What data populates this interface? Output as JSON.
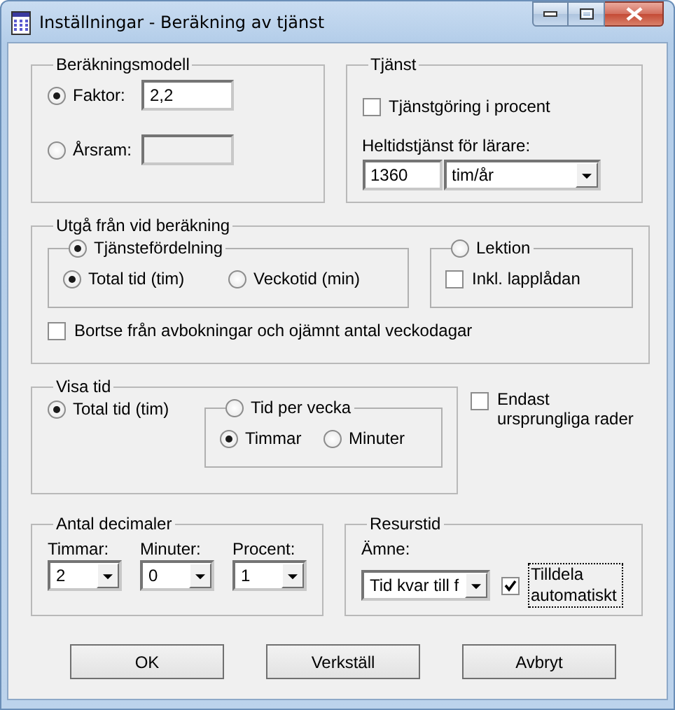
{
  "window": {
    "title": "Inställningar - Beräkning av tjänst"
  },
  "calculation_model": {
    "title": "Beräkningsmodell",
    "options": [
      {
        "label": "Faktor:",
        "selected": true,
        "value": "2,2",
        "disabled": false
      },
      {
        "label": "Årsram:",
        "selected": false,
        "disabled": true
      }
    ]
  },
  "service": {
    "title": "Tjänst",
    "percent": {
      "label": "Tjänstgöring i procent",
      "checked": false
    },
    "field_label": "Heltidstjänst för lärare:",
    "value": "1360",
    "unit": "tim/år"
  },
  "base": {
    "title": "Utgå från vid beräkning",
    "sources": [
      {
        "kind": "radios",
        "label": "Tjänstefördelning",
        "selected": true,
        "options": [
          {
            "label": "Total tid (tim)",
            "selected": true
          },
          {
            "label": "Veckotid (min)",
            "selected": false
          }
        ]
      },
      {
        "kind": "checkbox",
        "label": "Lektion",
        "selected": false,
        "checkbox": {
          "label": "Inkl. lapplådan",
          "checked": false
        }
      }
    ],
    "ignore": {
      "label": "Bortse från avbokningar och ojämnt antal veckodagar",
      "checked": false
    }
  },
  "show_time": {
    "title": "Visa tid",
    "options": [
      {
        "label": "Total tid (tim)",
        "selected": true
      },
      {
        "label": "Tid per vecka",
        "selected": false,
        "sub_options": [
          {
            "label": "Timmar",
            "selected": true
          },
          {
            "label": "Minuter",
            "selected": false
          }
        ]
      }
    ]
  },
  "original_rows": {
    "label": "Endast ursprungliga rader",
    "checked": false
  },
  "decimals": {
    "title": "Antal decimaler",
    "fields": [
      {
        "label": "Timmar:",
        "value": "2"
      },
      {
        "label": "Minuter:",
        "value": "0"
      },
      {
        "label": "Procent:",
        "value": "1"
      }
    ]
  },
  "resource_time": {
    "title": "Resurstid",
    "field_label": "Ämne:",
    "value": "Tid kvar till f",
    "auto": {
      "label": "Tilldela automatiskt",
      "checked": true,
      "focused": true
    }
  },
  "buttons": [
    "OK",
    "Verkställ",
    "Avbryt"
  ]
}
